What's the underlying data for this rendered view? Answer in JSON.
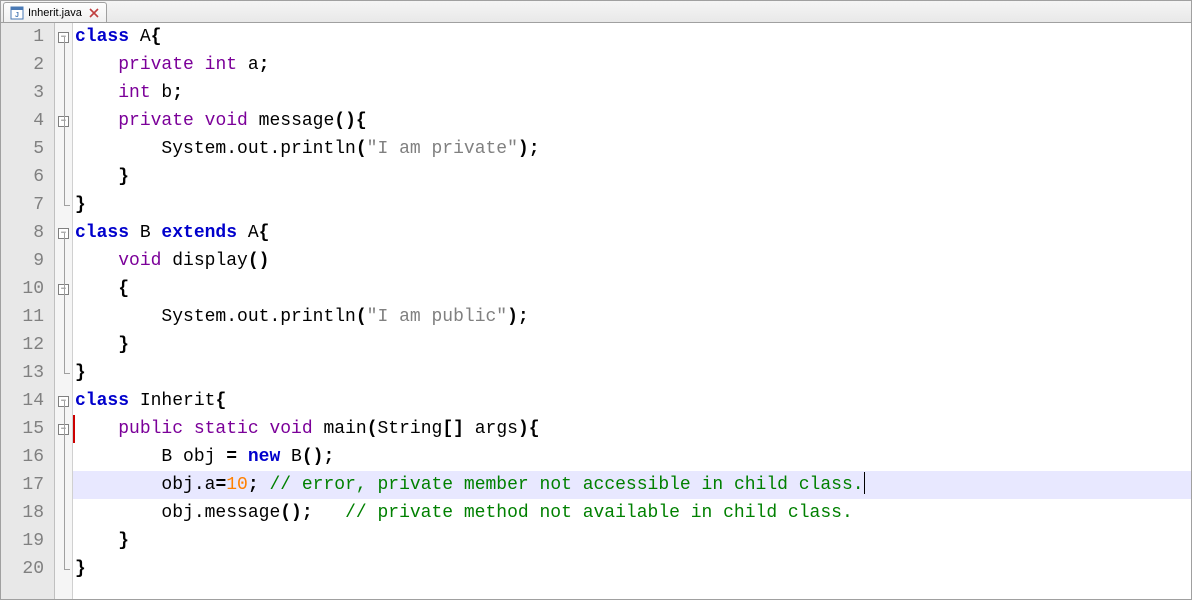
{
  "tab": {
    "filename": "Inherit.java"
  },
  "lines": {
    "line1": "1",
    "line2": "2",
    "line3": "3",
    "line4": "4",
    "line5": "5",
    "line6": "6",
    "line7": "7",
    "line8": "8",
    "line9": "9",
    "line10": "10",
    "line11": "11",
    "line12": "12",
    "line13": "13",
    "line14": "14",
    "line15": "15",
    "line16": "16",
    "line17": "17",
    "line18": "18",
    "line19": "19",
    "line20": "20"
  },
  "code": {
    "l1_class": "class",
    "l1_name": " A",
    "l1_brace": "{",
    "l2_indent": "    ",
    "l2_private": "private",
    "l2_int": " int",
    "l2_var": " a",
    "l2_semi": ";",
    "l3_indent": "    ",
    "l3_int": "int",
    "l3_var": " b",
    "l3_semi": ";",
    "l4_indent": "    ",
    "l4_private": "private",
    "l4_void": " void",
    "l4_name": " message",
    "l4_paren": "(){",
    "l5_indent": "        ",
    "l5_sys": "System",
    "l5_out": ".out.println",
    "l5_p1": "(",
    "l5_str": "\"I am private\"",
    "l5_p2": ");",
    "l6_indent": "    ",
    "l6_brace": "}",
    "l7_brace": "}",
    "l8_class": "class",
    "l8_name": " B ",
    "l8_extends": "extends",
    "l8_super": " A",
    "l8_brace": "{",
    "l9_indent": "    ",
    "l9_void": "void",
    "l9_name": " display",
    "l9_paren": "()",
    "l10_indent": "    ",
    "l10_brace": "{",
    "l11_indent": "        ",
    "l11_sys": "System",
    "l11_out": ".out.println",
    "l11_p1": "(",
    "l11_str": "\"I am public\"",
    "l11_p2": ");",
    "l12_indent": "    ",
    "l12_brace": "}",
    "l13_brace": "}",
    "l14_class": "class",
    "l14_name": " Inherit",
    "l14_brace": "{",
    "l15_indent": "    ",
    "l15_public": "public",
    "l15_static": " static",
    "l15_void": " void",
    "l15_name": " main",
    "l15_p1": "(",
    "l15_string": "String",
    "l15_arr": "[] ",
    "l15_args": "args",
    "l15_p2": "){",
    "l16_indent": "        ",
    "l16_type": "B obj ",
    "l16_eq": "= ",
    "l16_new": "new",
    "l16_call": " B",
    "l16_p": "();",
    "l17_indent": "        ",
    "l17_obj": "obj",
    "l17_dot": ".a",
    "l17_eq": "=",
    "l17_num": "10",
    "l17_semi": "; ",
    "l17_comment": "// error, private member not accessible in child class.",
    "l18_indent": "        ",
    "l18_obj": "obj",
    "l18_call": ".message",
    "l18_p": "();   ",
    "l18_comment": "// private method not available in child class.",
    "l19_indent": "    ",
    "l19_brace": "}",
    "l20_brace": "}"
  }
}
